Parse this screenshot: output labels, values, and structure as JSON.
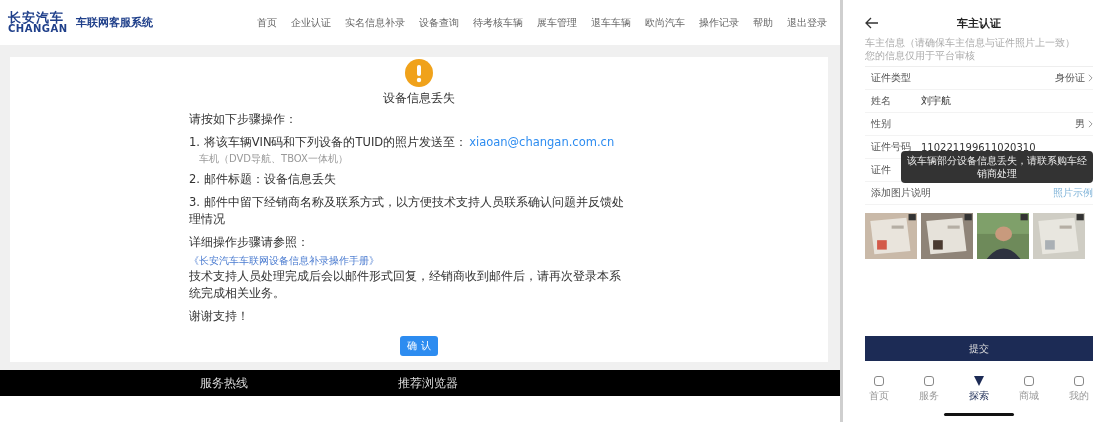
{
  "header": {
    "logo_cn": "长安汽车",
    "logo_en": "CHANGAN",
    "system_title": "车联网客服系统",
    "nav": [
      {
        "label": "首页"
      },
      {
        "label": "企业认证"
      },
      {
        "label": "实名信息补录"
      },
      {
        "label": "设备查询"
      },
      {
        "label": "待考核车辆"
      },
      {
        "label": "展车管理"
      },
      {
        "label": "退车车辆"
      },
      {
        "label": "欧尚汽车"
      },
      {
        "label": "操作记录"
      },
      {
        "label": "帮助"
      },
      {
        "label": "退出登录"
      }
    ]
  },
  "dialog": {
    "title": "设备信息丢失",
    "intro": "请按如下步骤操作：",
    "steps": [
      {
        "kind": "step",
        "text": "1. 将该车辆VIN码和下列设备的TUID的照片发送至：",
        "link": "xiaoan@changan.com.cn"
      },
      {
        "kind": "sub",
        "text": "车机（DVD导航、TBOX一体机）"
      },
      {
        "kind": "step",
        "text": "2. 邮件标题：设备信息丢失"
      },
      {
        "kind": "step",
        "text": "3. 邮件中留下经销商名称及联系方式，以方便技术支持人员联系确认问题并反馈处理情况"
      }
    ],
    "detail_label": "详细操作步骤请参照：",
    "manual_link": "《长安汽车车联网设备信息补录操作手册》",
    "reply_note": "技术支持人员处理完成后会以邮件形式回复，经销商收到邮件后，请再次登录本系统完成相关业务。",
    "thanks": "谢谢支持！",
    "confirm": "确 认"
  },
  "footer": [
    "服务热线",
    "推荐浏览器"
  ],
  "phone": {
    "title": "车主认证",
    "hint": [
      "车主信息（请确保车主信息与证件照片上一致）",
      "您的信息仅用于平台审核"
    ],
    "rows": [
      {
        "kind": "select",
        "label": "证件类型",
        "value": "身份证"
      },
      {
        "kind": "text",
        "label": "姓名",
        "value": "刘宇航"
      },
      {
        "kind": "select",
        "label": "性别",
        "value": "男"
      },
      {
        "kind": "text",
        "label": "证件号码",
        "value": "110221199611020310"
      },
      {
        "kind": "text",
        "label": "证件"
      }
    ],
    "toast": "该车辆部分设备信息丢失，请联系购车经销商处理",
    "photo_label": "添加图片说明",
    "photo_example": "照片示例",
    "submit": "提交",
    "tabs": [
      {
        "label": "首页",
        "selected": false
      },
      {
        "label": "服务",
        "selected": false
      },
      {
        "label": "探索",
        "selected": true
      },
      {
        "label": "商城",
        "selected": false
      },
      {
        "label": "我的",
        "selected": false
      }
    ]
  }
}
